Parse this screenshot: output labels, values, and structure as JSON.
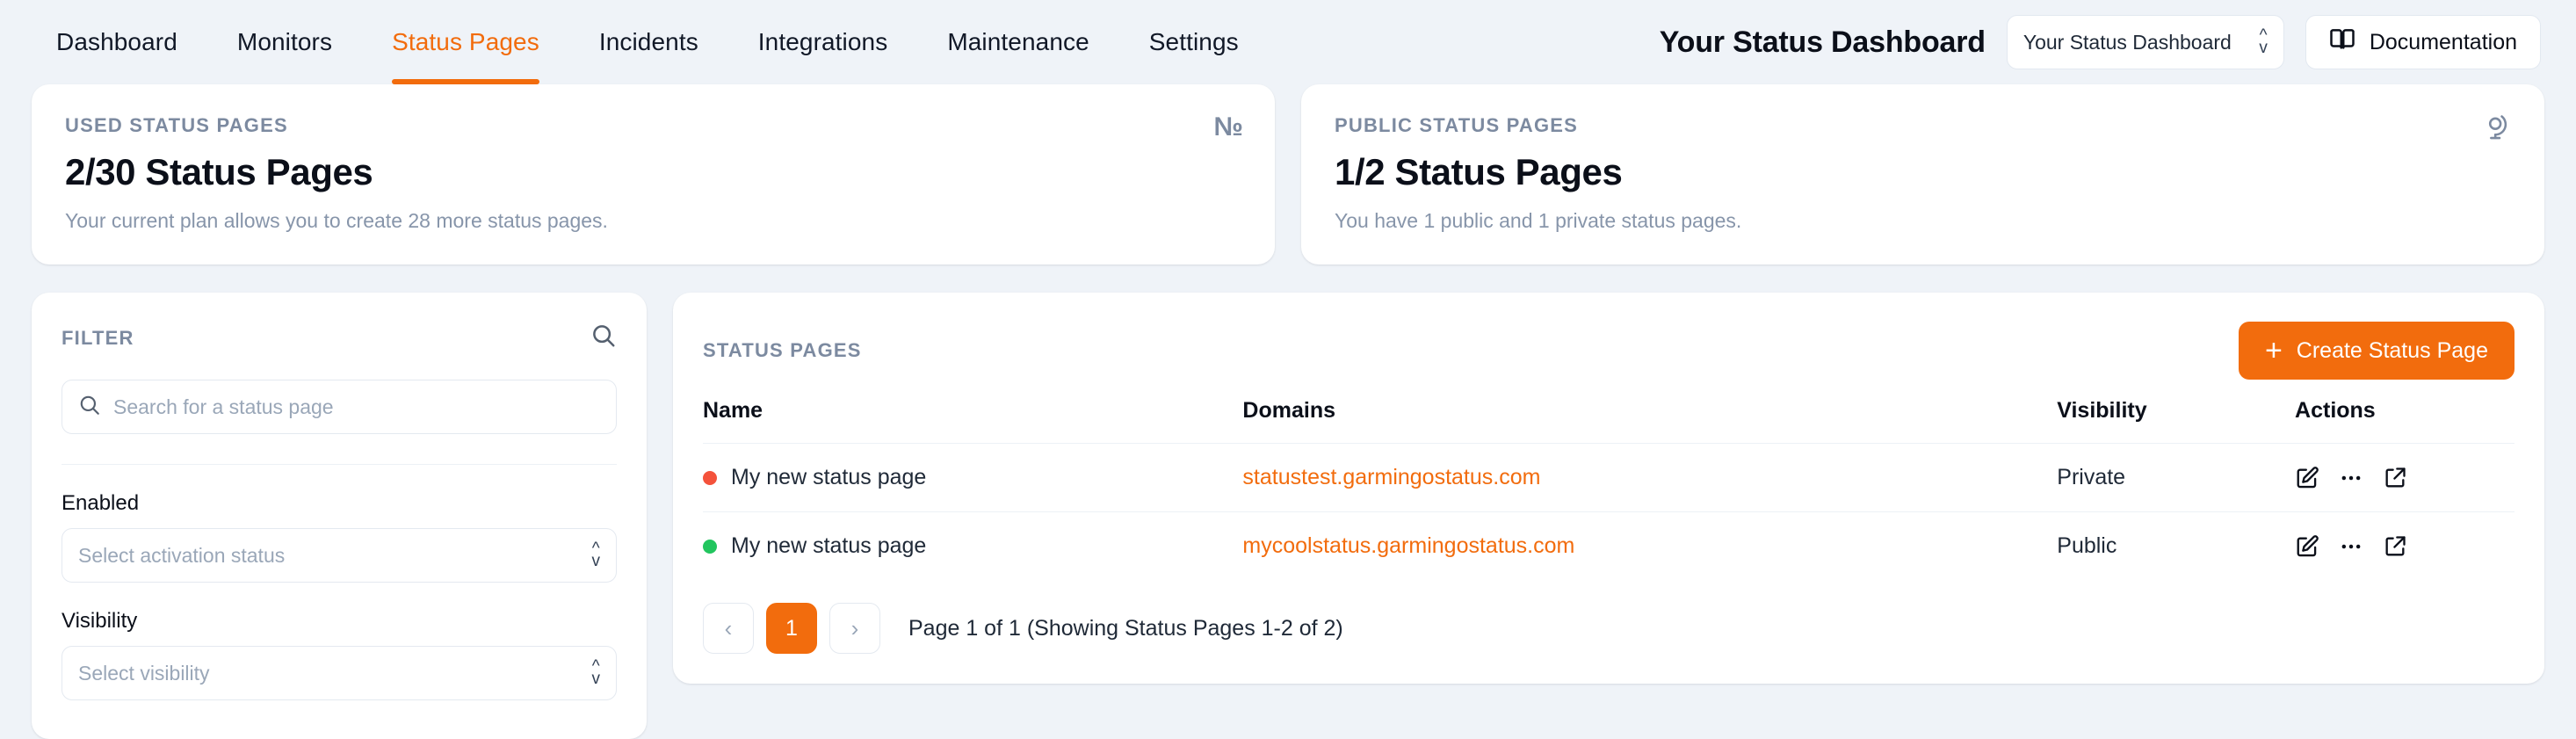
{
  "nav": {
    "items": [
      {
        "label": "Dashboard",
        "active": false
      },
      {
        "label": "Monitors",
        "active": false
      },
      {
        "label": "Status Pages",
        "active": true
      },
      {
        "label": "Incidents",
        "active": false
      },
      {
        "label": "Integrations",
        "active": false
      },
      {
        "label": "Maintenance",
        "active": false
      },
      {
        "label": "Settings",
        "active": false
      }
    ]
  },
  "header": {
    "brand_title": "Your Status Dashboard",
    "dashboard_select_value": "Your Status Dashboard",
    "documentation_label": "Documentation"
  },
  "stats": [
    {
      "label": "USED STATUS PAGES",
      "value": "2/30 Status Pages",
      "description": "Your current plan allows you to create 28 more status pages.",
      "icon": "numero-icon",
      "icon_glyph": "№"
    },
    {
      "label": "PUBLIC STATUS PAGES",
      "value": "1/2 Status Pages",
      "description": "You have 1 public and 1 private status pages.",
      "icon": "globe-icon",
      "icon_glyph": ""
    }
  ],
  "filter": {
    "title": "FILTER",
    "search_placeholder": "Search for a status page",
    "search_value": "",
    "fields": [
      {
        "label": "Enabled",
        "placeholder": "Select activation status",
        "value": ""
      },
      {
        "label": "Visibility",
        "placeholder": "Select visibility",
        "value": ""
      }
    ]
  },
  "table": {
    "title": "STATUS PAGES",
    "create_label": "Create Status Page",
    "columns": [
      "Name",
      "Domains",
      "Visibility",
      "Actions"
    ],
    "rows": [
      {
        "status_color": "#f4523b",
        "name": "My new status page",
        "domain": "statustest.garmingostatus.com",
        "visibility": "Private"
      },
      {
        "status_color": "#22c55e",
        "name": "My new status page",
        "domain": "mycoolstatus.garmingostatus.com",
        "visibility": "Public"
      }
    ],
    "pagination": {
      "prev": "‹",
      "next": "›",
      "current_page": "1",
      "summary": "Page 1 of 1 (Showing Status Pages 1-2 of 2)"
    }
  },
  "colors": {
    "accent": "#f26c0d",
    "page_bg": "#eff3f8",
    "card_bg": "#ffffff",
    "muted_text": "#7c8aa0"
  }
}
